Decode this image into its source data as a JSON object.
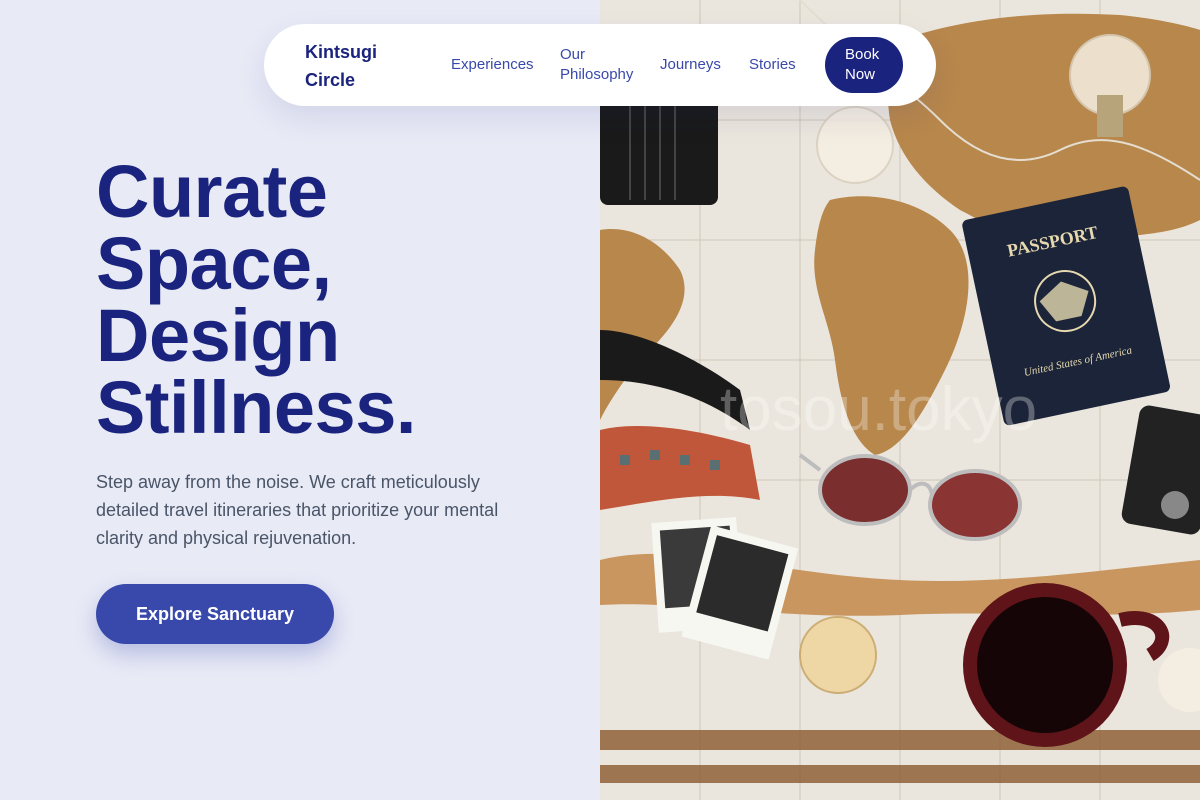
{
  "nav": {
    "brand": "Kintsugi Circle",
    "links": [
      "Experiences",
      "Our Philosophy",
      "Journeys",
      "Stories"
    ],
    "cta": "Book Now"
  },
  "hero": {
    "title_lines": [
      "Curate",
      "Space,",
      "Design",
      "Stillness."
    ],
    "subtitle": "Step away from the noise. We craft meticulously detailed travel itineraries that prioritize your mental clarity and physical rejuvenation.",
    "cta": "Explore Sanctuary"
  },
  "photo": {
    "passport_title": "PASSPORT",
    "passport_country": "United States of America",
    "watermark": "tosou.tokyo",
    "colors": {
      "map_ocean": "#ebe6dd",
      "map_land": "#b8874c",
      "passport": "#1b2438",
      "mug": "#5e1418"
    }
  },
  "colors": {
    "background": "#e8eaf6",
    "navy": "#1a237e",
    "accent": "#3949ab",
    "body_text": "#4a5568"
  }
}
